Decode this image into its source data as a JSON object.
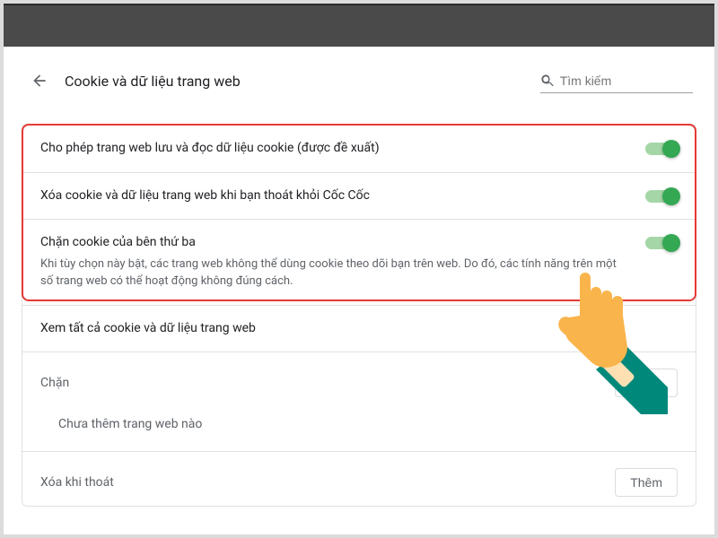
{
  "header": {
    "title": "Cookie và dữ liệu trang web",
    "search_placeholder": "Tìm kiếm"
  },
  "options": [
    {
      "label": "Cho phép trang web lưu và đọc dữ liệu cookie (được đề xuất)",
      "desc": "",
      "on": true
    },
    {
      "label": "Xóa cookie và dữ liệu trang web khi bạn thoát khỏi Cốc Cốc",
      "desc": "",
      "on": true
    },
    {
      "label": "Chặn cookie của bên thứ ba",
      "desc": "Khi tùy chọn này bật, các trang web không thể dùng cookie theo dõi bạn trên web. Do đó, các tính năng trên một số trang web có thể hoạt động không đúng cách.",
      "on": true
    }
  ],
  "view_all": {
    "label": "Xem tất cả cookie và dữ liệu trang web"
  },
  "sections": {
    "block": {
      "title": "Chặn",
      "empty": "Chưa thêm trang web nào",
      "add": "Thêm"
    },
    "clear_on_exit": {
      "title": "Xóa khi thoát",
      "add": "Thêm"
    }
  },
  "colors": {
    "accent": "#34a853",
    "danger": "#e53935"
  }
}
